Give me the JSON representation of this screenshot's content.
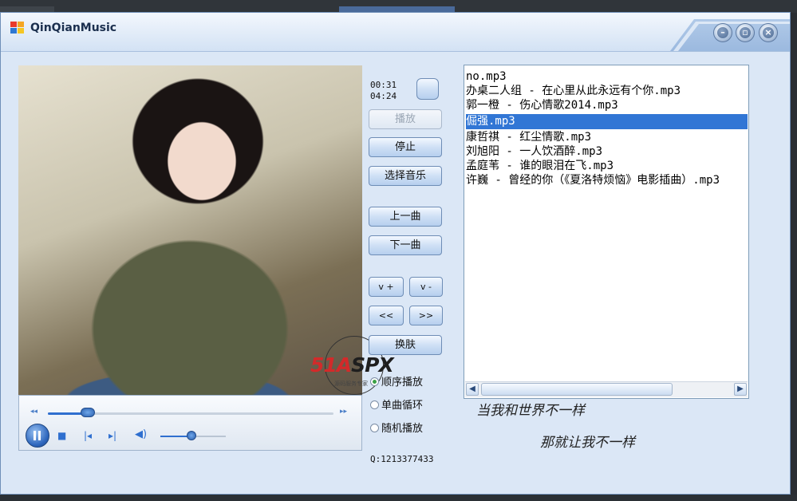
{
  "window": {
    "title": "QinQianMusic",
    "buttons": [
      "minimize",
      "maximize",
      "close"
    ]
  },
  "player_time": {
    "current": "00:31",
    "total": "04:24"
  },
  "buttons": {
    "play": "播放",
    "stop": "停止",
    "select_music": "选择音乐",
    "prev": "上一曲",
    "next": "下一曲",
    "vol_up": "v +",
    "vol_down": "v -",
    "rewind": "<<",
    "forward": ">>",
    "skin": "换肤"
  },
  "play_modes": [
    {
      "label": "顺序播放",
      "checked": true
    },
    {
      "label": "单曲循环",
      "checked": false
    },
    {
      "label": "随机播放",
      "checked": false
    }
  ],
  "qq": "Q:1213377433",
  "playlist": {
    "selected_index": 3,
    "items": [
      "no.mp3",
      "办桌二人组 - 在心里从此永远有个你.mp3",
      "郭一橙 - 伤心情歌2014.mp3",
      "倔强.mp3",
      "康哲祺 - 红尘情歌.mp3",
      "刘旭阳 - 一人饮酒醉.mp3",
      "孟庭苇 - 谁的眼泪在飞.mp3",
      "许巍 - 曾经的你（《夏洛特烦恼》电影插曲）.mp3"
    ]
  },
  "lyrics": {
    "line1": "当我和世界不一样",
    "line2": "那就让我不一样"
  },
  "media_progress": {
    "seek_fraction": 0.14,
    "volume_fraction": 0.48
  },
  "watermark": {
    "brand": "51ASPX",
    "sub": "源码服务专家"
  },
  "colors": {
    "accent": "#3176d5",
    "window_bg": "#dbe7f6",
    "titlebar": "#d3e2f4"
  },
  "icons": {
    "app": "app-logo-icon",
    "minimize": "minimize-icon",
    "maximize": "maximize-icon",
    "close": "close-icon",
    "pause": "pause-icon",
    "stop": "stop-icon",
    "prev": "previous-track-icon",
    "next": "next-track-icon",
    "volume": "speaker-icon"
  }
}
